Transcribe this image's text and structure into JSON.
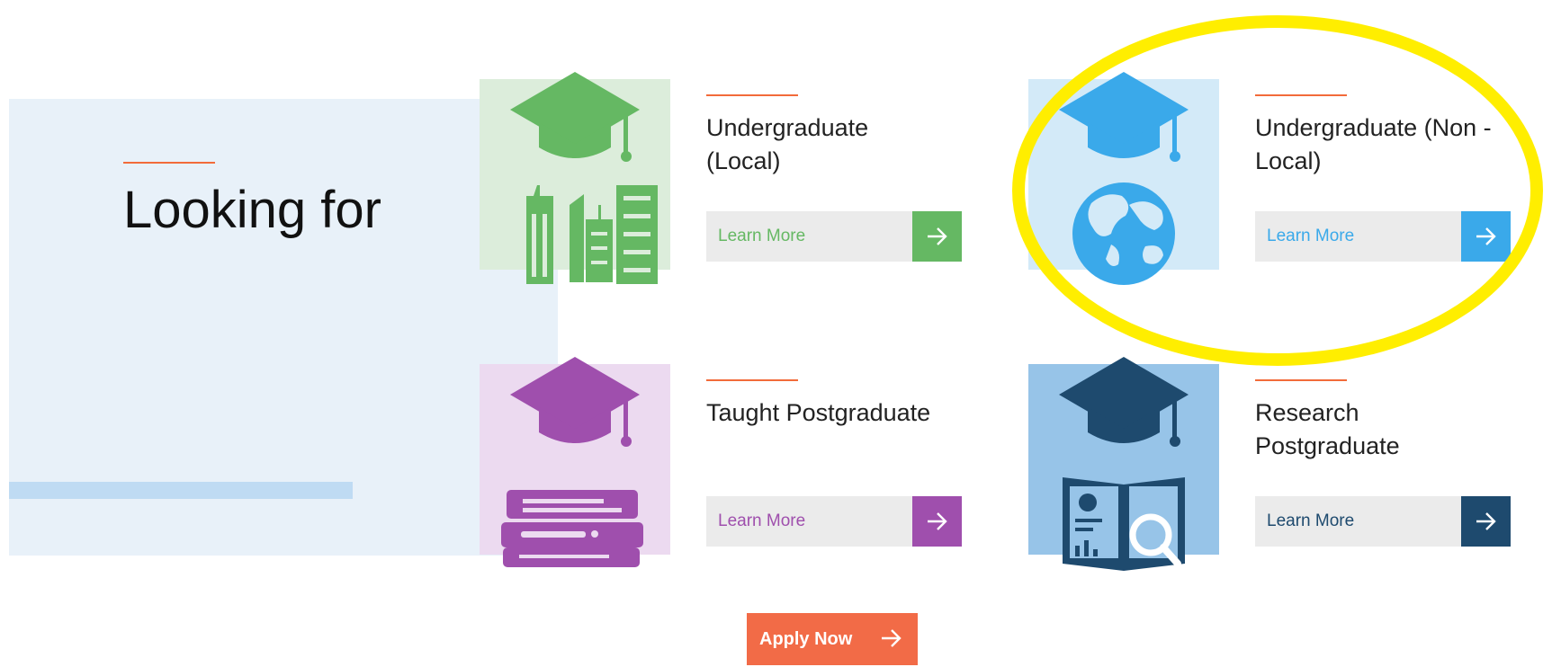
{
  "intro": {
    "title": "Looking for"
  },
  "programmes": [
    {
      "title": "Undergraduate\n(Local)",
      "button_label": "Learn More",
      "accent": "#65b863",
      "bg": "#dceddb"
    },
    {
      "title": "Undergraduate (Non -\nLocal)",
      "button_label": "Learn More",
      "accent": "#3aa9ea",
      "bg": "#d3eaf8"
    },
    {
      "title": "Taught Postgraduate",
      "button_label": "Learn More",
      "accent": "#9f4fad",
      "bg": "#ecdaf0"
    },
    {
      "title": "Research\nPostgraduate",
      "button_label": "Learn More",
      "accent": "#1e4a6e",
      "bg": "#97c4e8"
    }
  ],
  "apply": {
    "label": "Apply Now"
  },
  "colors": {
    "orange": "#f26b47",
    "panel": "#e8f1f9"
  },
  "icons": [
    "graduation-cap-icon",
    "city-buildings-icon",
    "globe-icon",
    "books-icon",
    "research-report-icon",
    "arrow-right-icon"
  ]
}
